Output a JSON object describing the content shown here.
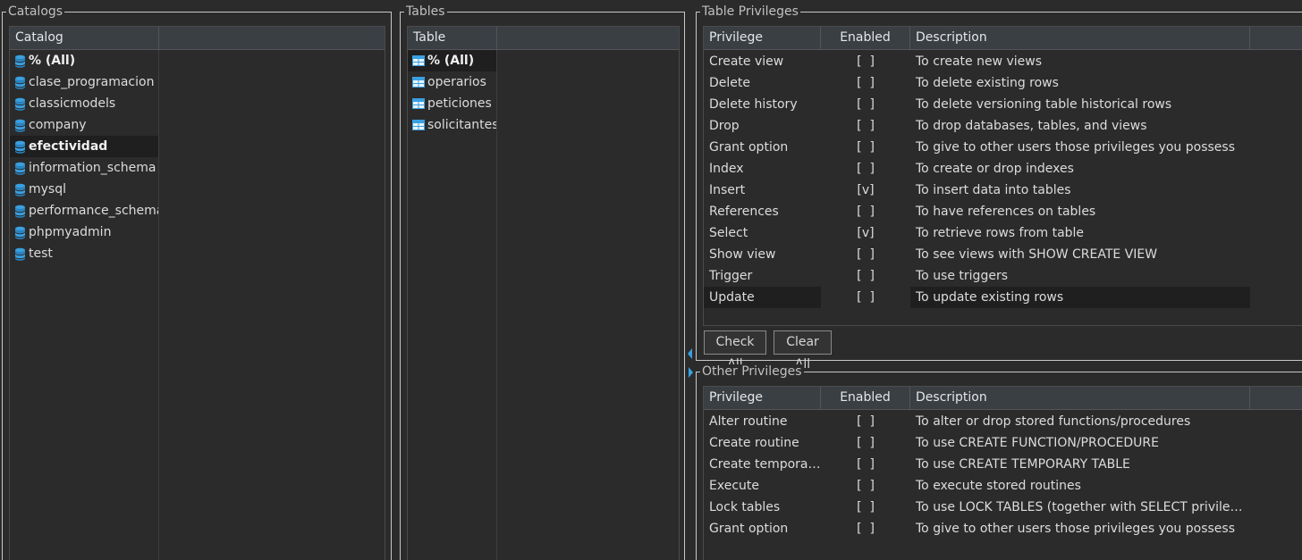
{
  "catalogs": {
    "group_title": "Catalogs",
    "column_header": "Catalog",
    "items": [
      {
        "label": "% (All)",
        "bold": true
      },
      {
        "label": "clase_programacion",
        "bold": false
      },
      {
        "label": "classicmodels",
        "bold": false
      },
      {
        "label": "company",
        "bold": false
      },
      {
        "label": "efectividad",
        "bold": true
      },
      {
        "label": "information_schema",
        "bold": false
      },
      {
        "label": "mysql",
        "bold": false
      },
      {
        "label": "performance_schema",
        "bold": false
      },
      {
        "label": "phpmyadmin",
        "bold": false
      },
      {
        "label": "test",
        "bold": false
      }
    ],
    "icon": "database-icon"
  },
  "tables": {
    "group_title": "Tables",
    "column_header": "Table",
    "items": [
      {
        "label": "% (All)",
        "bold": true
      },
      {
        "label": "operarios",
        "bold": false
      },
      {
        "label": "peticiones",
        "bold": false
      },
      {
        "label": "solicitantes",
        "bold": false
      }
    ],
    "icon": "table-icon"
  },
  "table_privileges": {
    "group_title": "Table Privileges",
    "headers": {
      "privilege": "Privilege",
      "enabled": "Enabled",
      "description": "Description"
    },
    "rows": [
      {
        "privilege": "Create view",
        "enabled": "[  ]",
        "description": "To create new views"
      },
      {
        "privilege": "Delete",
        "enabled": "[  ]",
        "description": "To delete existing rows"
      },
      {
        "privilege": "Delete history",
        "enabled": "[  ]",
        "description": "To delete versioning table historical rows"
      },
      {
        "privilege": "Drop",
        "enabled": "[  ]",
        "description": "To drop databases, tables, and views"
      },
      {
        "privilege": "Grant option",
        "enabled": "[  ]",
        "description": "To give to other users those privileges you possess"
      },
      {
        "privilege": "Index",
        "enabled": "[  ]",
        "description": "To create or drop indexes"
      },
      {
        "privilege": "Insert",
        "enabled": "[v]",
        "description": "To insert data into tables"
      },
      {
        "privilege": "References",
        "enabled": "[  ]",
        "description": "To have references on tables"
      },
      {
        "privilege": "Select",
        "enabled": "[v]",
        "description": "To retrieve rows from table"
      },
      {
        "privilege": "Show view",
        "enabled": "[  ]",
        "description": "To see views with SHOW CREATE VIEW"
      },
      {
        "privilege": "Trigger",
        "enabled": "[  ]",
        "description": "To use triggers"
      },
      {
        "privilege": "Update",
        "enabled": "[  ]",
        "description": "To update existing rows"
      }
    ],
    "check_all_label": "Check All",
    "clear_all_label": "Clear All"
  },
  "other_privileges": {
    "group_title": "Other Privileges",
    "headers": {
      "privilege": "Privilege",
      "enabled": "Enabled",
      "description": "Description"
    },
    "rows": [
      {
        "privilege": "Alter routine",
        "enabled": "[  ]",
        "description": "To alter or drop stored functions/procedures"
      },
      {
        "privilege": "Create routine",
        "enabled": "[  ]",
        "description": "To use CREATE FUNCTION/PROCEDURE"
      },
      {
        "privilege": "Create temporar...",
        "enabled": "[  ]",
        "description": "To use CREATE TEMPORARY TABLE"
      },
      {
        "privilege": "Execute",
        "enabled": "[  ]",
        "description": "To execute stored routines"
      },
      {
        "privilege": "Lock tables",
        "enabled": "[  ]",
        "description": "To use LOCK TABLES (together with SELECT privilege)"
      },
      {
        "privilege": "Grant option",
        "enabled": "[  ]",
        "description": "To give to other users those privileges you possess"
      }
    ]
  },
  "colors": {
    "background": "#2b2b2b",
    "header_bg": "#3a3f44",
    "icon_blue": "#3aa0e0",
    "selected_row_bg": "#1f1f1f"
  }
}
